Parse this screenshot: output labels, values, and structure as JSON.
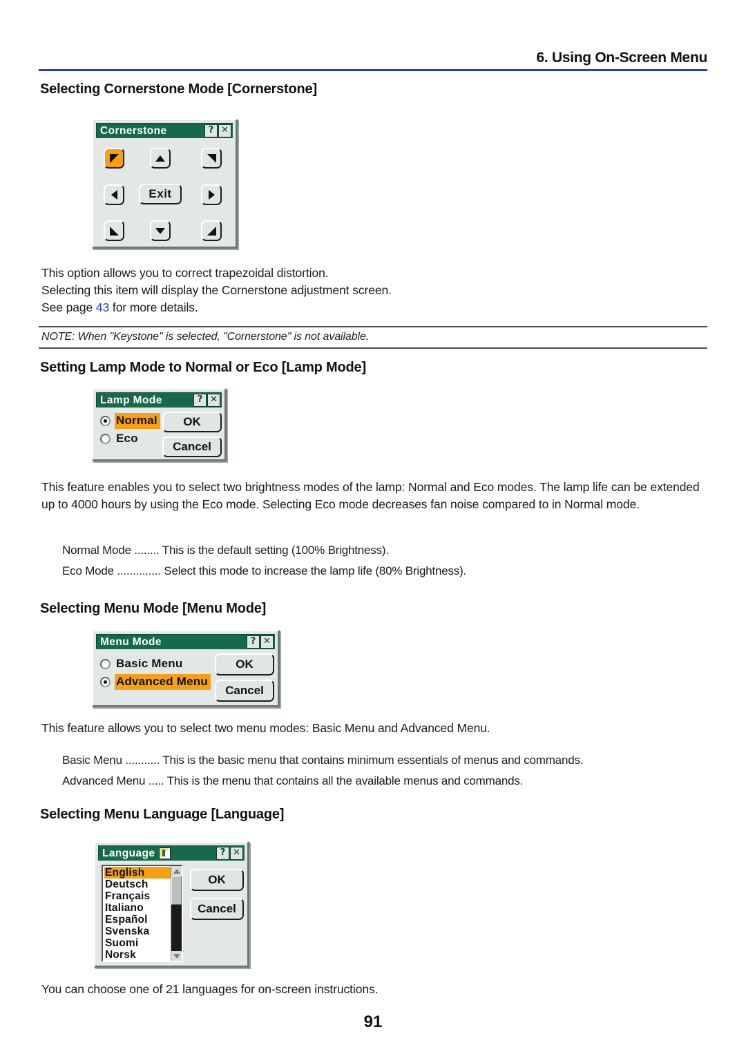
{
  "header": {
    "chapter": "6. Using On-Screen Menu"
  },
  "sections": {
    "cornerstone": {
      "heading": "Selecting Cornerstone Mode [Cornerstone]",
      "dialog": {
        "title": "Cornerstone",
        "help_button": "?",
        "close_button": "✕",
        "exit_label": "Exit",
        "buttons": [
          "corner-top-left",
          "arrow-up",
          "corner-top-right",
          "arrow-left",
          "exit",
          "arrow-right",
          "corner-bottom-left",
          "arrow-down",
          "corner-bottom-right"
        ],
        "selected_button": "corner-top-left"
      },
      "paragraph_line1": "This option allows you to correct trapezoidal distortion.",
      "paragraph_line2": "Selecting this item will display the Cornerstone adjustment screen.",
      "paragraph_line3_prefix": "See page ",
      "page_reference": "43",
      "paragraph_line3_suffix": " for more details.",
      "note": "NOTE: When \"Keystone\" is selected, \"Cornerstone\" is not available."
    },
    "lamp_mode": {
      "heading": "Setting Lamp Mode to Normal or Eco [Lamp Mode]",
      "dialog": {
        "title": "Lamp Mode",
        "help_button": "?",
        "close_button": "✕",
        "options": [
          {
            "label": "Normal",
            "selected": true
          },
          {
            "label": "Eco",
            "selected": false
          }
        ],
        "ok_label": "OK",
        "cancel_label": "Cancel"
      },
      "paragraph": "This feature enables you to select two brightness modes of the lamp: Normal and Eco modes. The lamp life can be extended up to 4000 hours by using the Eco mode. Selecting Eco mode decreases fan noise compared to in Normal mode.",
      "definitions": [
        "Normal Mode ........ This is the default setting (100% Brightness).",
        "Eco Mode .............. Select this mode to increase the lamp life (80% Brightness)."
      ]
    },
    "menu_mode": {
      "heading": "Selecting Menu Mode [Menu Mode]",
      "dialog": {
        "title": "Menu Mode",
        "help_button": "?",
        "close_button": "✕",
        "options": [
          {
            "label": "Basic Menu",
            "selected": false
          },
          {
            "label": "Advanced Menu",
            "selected": true
          }
        ],
        "ok_label": "OK",
        "cancel_label": "Cancel"
      },
      "paragraph": "This feature allows you to select two menu modes: Basic Menu and Advanced Menu.",
      "definitions": [
        "Basic Menu ........... This is the basic menu that contains minimum essentials of menus and commands.",
        "Advanced Menu ..... This is the menu that contains all the available menus and commands."
      ]
    },
    "language": {
      "heading": "Selecting Menu Language [Language]",
      "dialog": {
        "title": "Language",
        "help_button": "?",
        "close_button": "✕",
        "items": [
          "English",
          "Deutsch",
          "Français",
          "Italiano",
          "Español",
          "Svenska",
          "Suomi",
          "Norsk"
        ],
        "selected_item": "English",
        "ok_label": "OK",
        "cancel_label": "Cancel"
      },
      "paragraph": "You can choose one of 21 languages for on-screen instructions."
    }
  },
  "footer": {
    "page_number": "91"
  },
  "colors": {
    "accent_rule": "#2b3ad4",
    "titlebar_green": "#166a4c",
    "highlight_orange": "#f7a013",
    "dialog_face": "#e3e8e7"
  }
}
